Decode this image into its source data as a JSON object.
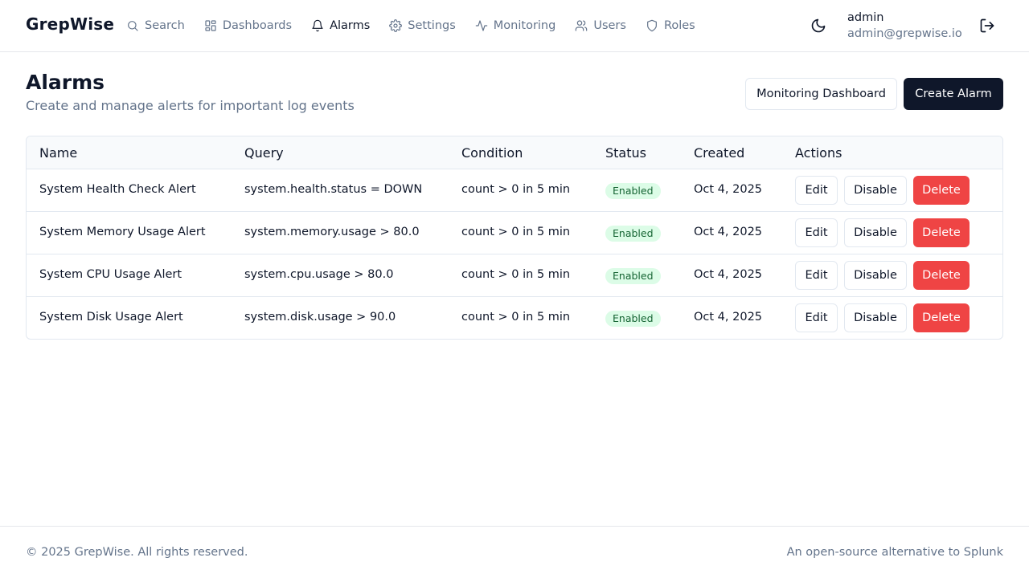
{
  "app": {
    "brand": "GrepWise"
  },
  "nav": [
    {
      "label": "Search",
      "icon": "search-icon",
      "active": false
    },
    {
      "label": "Dashboards",
      "icon": "dashboard-grid-icon",
      "active": false
    },
    {
      "label": "Alarms",
      "icon": "bell-icon",
      "active": true
    },
    {
      "label": "Settings",
      "icon": "gear-icon",
      "active": false
    },
    {
      "label": "Monitoring",
      "icon": "activity-icon",
      "active": false
    },
    {
      "label": "Users",
      "icon": "users-icon",
      "active": false
    },
    {
      "label": "Roles",
      "icon": "shield-icon",
      "active": false
    }
  ],
  "user": {
    "name": "admin",
    "email": "admin@grepwise.io"
  },
  "page": {
    "title": "Alarms",
    "subtitle": "Create and manage alerts for important log events",
    "monitoring_button": "Monitoring Dashboard",
    "create_button": "Create Alarm"
  },
  "table": {
    "headers": {
      "name": "Name",
      "query": "Query",
      "condition": "Condition",
      "status": "Status",
      "created": "Created",
      "actions": "Actions"
    },
    "action_labels": {
      "edit": "Edit",
      "disable": "Disable",
      "delete": "Delete"
    },
    "rows": [
      {
        "name": "System Health Check Alert",
        "query": "system.health.status = DOWN",
        "condition": "count > 0 in 5 min",
        "status": "Enabled",
        "created": "Oct 4, 2025"
      },
      {
        "name": "System Memory Usage Alert",
        "query": "system.memory.usage > 80.0",
        "condition": "count > 0 in 5 min",
        "status": "Enabled",
        "created": "Oct 4, 2025"
      },
      {
        "name": "System CPU Usage Alert",
        "query": "system.cpu.usage > 80.0",
        "condition": "count > 0 in 5 min",
        "status": "Enabled",
        "created": "Oct 4, 2025"
      },
      {
        "name": "System Disk Usage Alert",
        "query": "system.disk.usage > 90.0",
        "condition": "count > 0 in 5 min",
        "status": "Enabled",
        "created": "Oct 4, 2025"
      }
    ]
  },
  "footer": {
    "copyright": "© 2025 GrepWise. All rights reserved.",
    "tagline": "An open-source alternative to Splunk"
  },
  "colors": {
    "primary": "#0f172a",
    "muted": "#64748b",
    "danger": "#ef4444",
    "success_bg": "#dcfce7",
    "success_text": "#166534"
  }
}
